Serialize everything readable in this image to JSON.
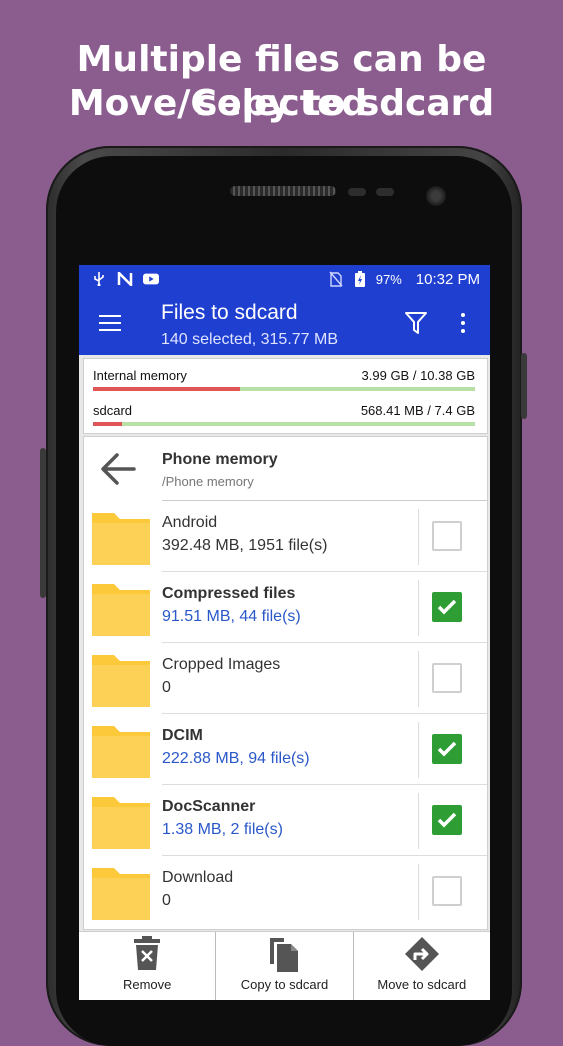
{
  "headline": {
    "line1": "Multiple files can be selected",
    "line2": "Move/Copy to sdcard"
  },
  "statusbar": {
    "battery": "97%",
    "time": "10:32 PM",
    "icons": [
      "usb-icon",
      "n-icon",
      "youtube-icon",
      "no-sim-icon",
      "battery-charging-icon"
    ]
  },
  "appbar": {
    "title": "Files to sdcard",
    "subtitle": "140 selected, 315.77 MB"
  },
  "storage": [
    {
      "label": "Internal memory",
      "value": "3.99 GB / 10.38 GB",
      "used_fraction": 0.384
    },
    {
      "label": "sdcard",
      "value": "568.41 MB / 7.4 GB",
      "used_fraction": 0.075
    }
  ],
  "list": {
    "title": "Phone memory",
    "path": "/Phone memory",
    "items": [
      {
        "name": "Android",
        "meta": "392.48 MB, 1951 file(s)",
        "checked": false
      },
      {
        "name": "Compressed files",
        "meta": "91.51 MB, 44 file(s)",
        "checked": true
      },
      {
        "name": "Cropped Images",
        "meta": "0",
        "checked": false
      },
      {
        "name": "DCIM",
        "meta": "222.88 MB, 94 file(s)",
        "checked": true
      },
      {
        "name": "DocScanner",
        "meta": "1.38 MB, 2 file(s)",
        "checked": true
      },
      {
        "name": "Download",
        "meta": "0",
        "checked": false
      }
    ]
  },
  "bottombar": {
    "remove": "Remove",
    "copy": "Copy to sdcard",
    "move": "Move to sdcard"
  },
  "colors": {
    "background": "#8a5d8e",
    "appbar": "#1f3fd1",
    "checkbox_on": "#2e9e34",
    "selected_meta": "#2a58c9",
    "folder": "#fcc93b",
    "bar_used": "#e05555",
    "bar_free": "#b7dfa6"
  }
}
